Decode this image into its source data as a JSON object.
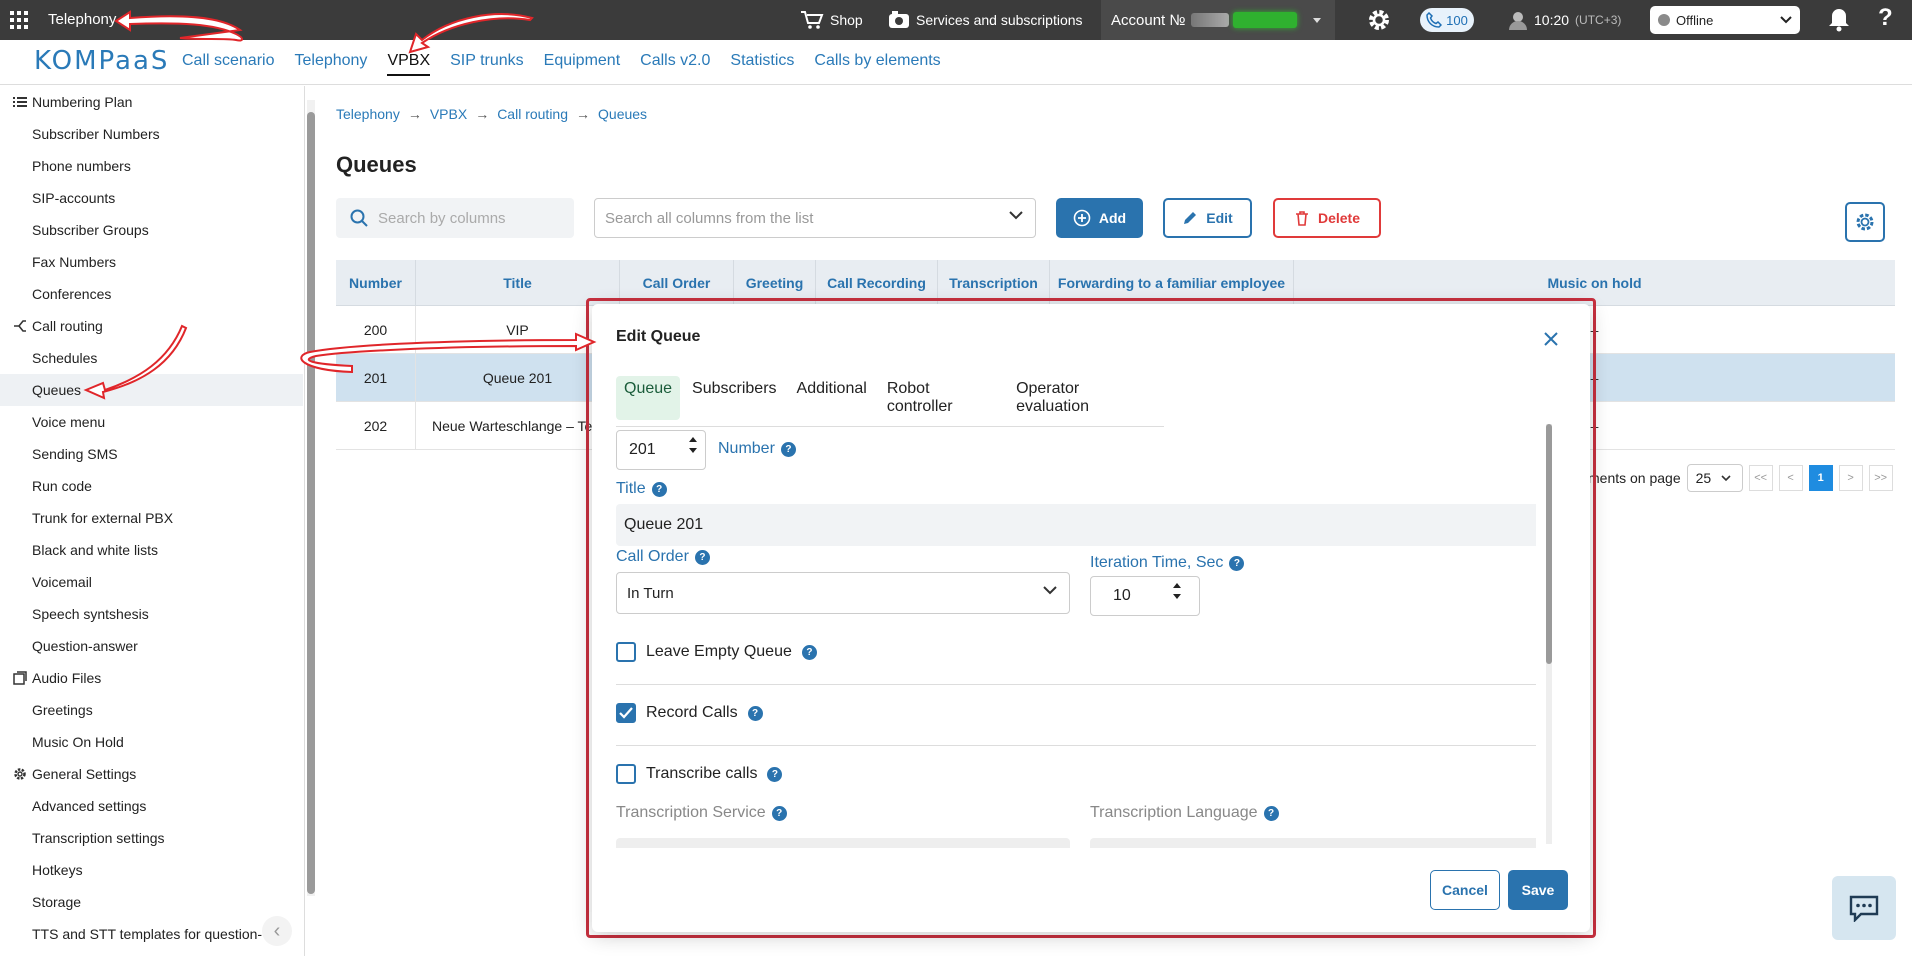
{
  "topbar": {
    "app_title": "Telephony",
    "shop_label": "Shop",
    "services_label": "Services and subscriptions",
    "account_label": "Account №",
    "calls_count": "100",
    "time": "10:20",
    "timezone": "(UTC+3)",
    "status_value": "Offline",
    "help_label": "?"
  },
  "nav": {
    "logo": "KOMPaaS",
    "items": [
      "Call scenario",
      "Telephony",
      "VPBX",
      "SIP trunks",
      "Equipment",
      "Calls v2.0",
      "Statistics",
      "Calls by elements"
    ],
    "active": "VPBX"
  },
  "sidebar": {
    "groups": [
      {
        "label": "Numbering Plan",
        "icon": "list-icon",
        "items": [
          "Subscriber Numbers",
          "Phone numbers",
          "SIP-accounts",
          "Subscriber Groups",
          "Fax Numbers",
          "Conferences"
        ]
      },
      {
        "label": "Call routing",
        "icon": "routing-icon",
        "items": [
          "Schedules",
          "Queues",
          "Voice menu",
          "Sending SMS",
          "Run code",
          "Trunk for external PBX",
          "Black and white lists",
          "Voicemail",
          "Speech syntshesis",
          "Question-answer"
        ]
      },
      {
        "label": "Audio Files",
        "icon": "audio-files-icon",
        "items": [
          "Greetings",
          "Music On Hold"
        ]
      },
      {
        "label": "General Settings",
        "icon": "gear-icon",
        "items": [
          "Advanced settings",
          "Transcription settings",
          "Hotkeys",
          "Storage",
          "TTS and STT templates for question-"
        ]
      }
    ],
    "selected": "Queues"
  },
  "breadcrumb": [
    "Telephony",
    "VPBX",
    "Call routing",
    "Queues"
  ],
  "page_title": "Queues",
  "toolbar": {
    "search_placeholder": "Search by columns",
    "columns_placeholder": "Search all columns from the list",
    "add_label": "Add",
    "edit_label": "Edit",
    "delete_label": "Delete"
  },
  "table": {
    "columns": [
      "Number",
      "Title",
      "Call Order",
      "Greeting",
      "Call Recording",
      "Transcription",
      "Forwarding to a familiar employee",
      "Music on hold"
    ],
    "rows": [
      {
        "number": "200",
        "title": "VIP",
        "music": "–"
      },
      {
        "number": "201",
        "title": "Queue 201",
        "music": "–"
      },
      {
        "number": "202",
        "title": "Neue Warteschlange – Te",
        "music": "–"
      }
    ],
    "selected_row": 1
  },
  "pager": {
    "label": "ments on page",
    "page_size": "25",
    "first": "<<",
    "prev": "<",
    "current": "1",
    "next": ">",
    "last": ">>"
  },
  "modal": {
    "title": "Edit Queue",
    "tabs": [
      "Queue",
      "Subscribers",
      "Additional",
      "Robot controller",
      "Operator evaluation"
    ],
    "active_tab": "Queue",
    "number_value": "201",
    "number_label": "Number",
    "title_label": "Title",
    "title_value": "Queue 201",
    "call_order_label": "Call Order",
    "call_order_value": "In Turn",
    "iteration_label": "Iteration Time, Sec",
    "iteration_value": "10",
    "leave_empty_label": "Leave Empty Queue",
    "leave_empty_checked": false,
    "record_calls_label": "Record Calls",
    "record_calls_checked": true,
    "transcribe_label": "Transcribe calls",
    "transcribe_checked": false,
    "transcription_service_label": "Transcription Service",
    "transcription_language_label": "Transcription Language",
    "help_glyph": "?",
    "cancel_label": "Cancel",
    "save_label": "Save"
  },
  "colors": {
    "accent": "#2a73ae",
    "danger": "#e03a3a",
    "highlight_outline": "#c8303f",
    "annotation_arrow": "#e0262a"
  }
}
